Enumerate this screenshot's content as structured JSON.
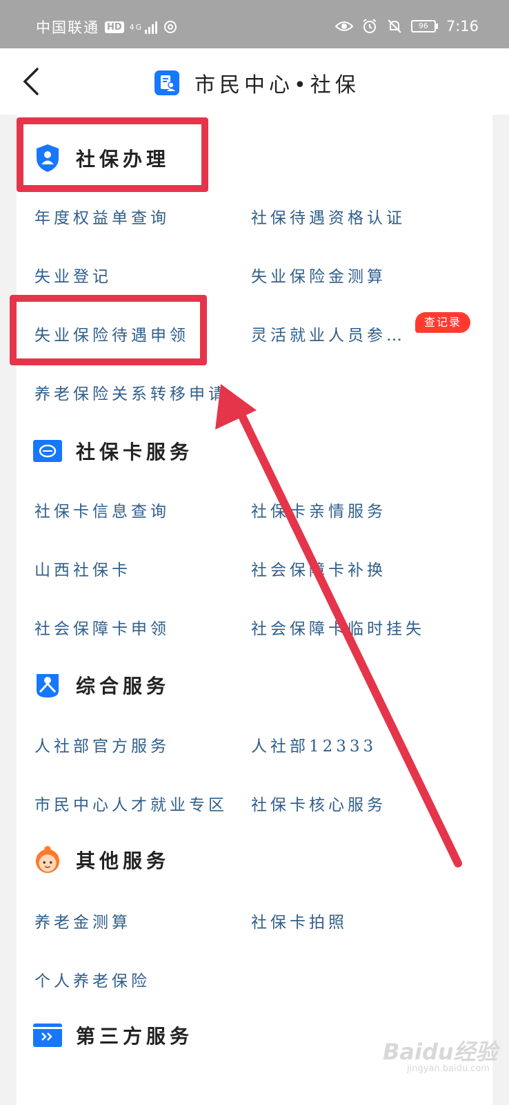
{
  "status_bar": {
    "carrier": "中国联通",
    "hd": "HD",
    "network": "4G",
    "battery": "96",
    "time": "7:16"
  },
  "nav": {
    "title": "市民中心•社保"
  },
  "sections": [
    {
      "title": "社保办理",
      "icon": "shield-user-icon",
      "items": [
        "年度权益单查询",
        "社保待遇资格认证",
        "失业登记",
        "失业保险金测算",
        "失业保险待遇申领",
        "灵活就业人员参…",
        "养老保险关系转移申请"
      ]
    },
    {
      "title": "社保卡服务",
      "icon": "social-security-card-icon",
      "items": [
        "社保卡信息查询",
        "社保卡亲情服务",
        "山西社保卡",
        "社会保障卡补换",
        "社会保障卡申领",
        "社会保障卡临时挂失"
      ]
    },
    {
      "title": "综合服务",
      "icon": "person-service-icon",
      "items": [
        "人社部官方服务",
        "人社部12333",
        "市民中心人才就业专区",
        "社保卡核心服务"
      ]
    },
    {
      "title": "其他服务",
      "icon": "avatar-face-icon",
      "items": [
        "养老金测算",
        "社保卡拍照",
        "个人养老保险"
      ]
    },
    {
      "title": "第三方服务",
      "icon": "forward-card-icon",
      "items": []
    }
  ],
  "badge": {
    "record": "查记录"
  },
  "watermark": {
    "brand": "Baidu经验",
    "url": "jingyan.baidu.com"
  },
  "colors": {
    "accent": "#1677ff",
    "link_text": "#2f5e8c",
    "annotation_red": "#e5354b",
    "badge_red": "#ff3b30"
  }
}
